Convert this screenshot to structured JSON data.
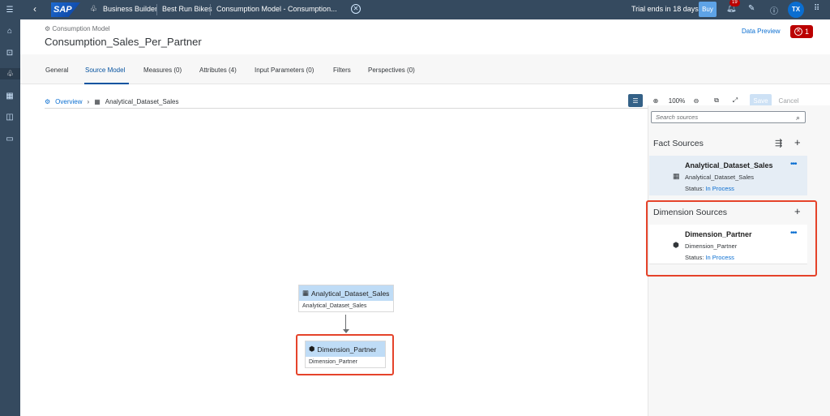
{
  "shell": {
    "breadcrumb": [
      "Business Builder",
      "Best Run Bikes",
      "Consumption Model - Consumption..."
    ],
    "trial_text": "Trial ends in 18 days",
    "buy_label": "Buy",
    "notifications_count": "19",
    "avatar_initials": "TX"
  },
  "header": {
    "subtitle": "Consumption Model",
    "title": "Consumption_Sales_Per_Partner",
    "data_preview_label": "Data Preview",
    "error_count": "1"
  },
  "tabs": [
    {
      "label": "General"
    },
    {
      "label": "Source Model"
    },
    {
      "label": "Measures (0)"
    },
    {
      "label": "Attributes (4)"
    },
    {
      "label": "Input Parameters (0)"
    },
    {
      "label": "Filters"
    },
    {
      "label": "Perspectives (0)"
    }
  ],
  "canvas": {
    "crumb_overview": "Overview",
    "crumb_current": "Analytical_Dataset_Sales",
    "zoom_level": "100%",
    "save_label": "Save",
    "cancel_label": "Cancel",
    "nodes": [
      {
        "title": "Analytical_Dataset_Sales",
        "subtitle": "Analytical_Dataset_Sales"
      },
      {
        "title": "Dimension_Partner",
        "subtitle": "Dimension_Partner"
      }
    ]
  },
  "panel": {
    "search_placeholder": "Search sources",
    "fact_title": "Fact Sources",
    "dimension_title": "Dimension Sources",
    "status_label": "Status:",
    "fact_items": [
      {
        "name": "Analytical_Dataset_Sales",
        "source": "Analytical_Dataset_Sales",
        "status": "In Process"
      }
    ],
    "dimension_items": [
      {
        "name": "Dimension_Partner",
        "source": "Dimension_Partner",
        "status": "In Process"
      }
    ]
  },
  "colors": {
    "shell": "#354a5f",
    "accent": "#0a6ed1",
    "node_header": "#bfdcf6",
    "highlight": "#e5432a",
    "error": "#bb0000"
  }
}
